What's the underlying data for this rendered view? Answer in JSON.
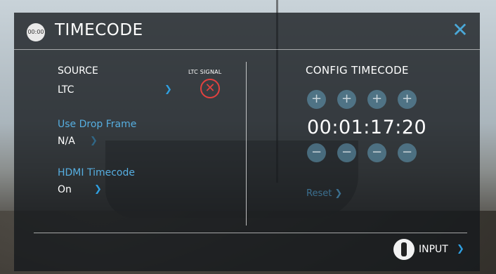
{
  "header": {
    "icon_text": "00:00",
    "title": "TIMECODE",
    "close_glyph": "✕"
  },
  "source": {
    "label": "SOURCE",
    "value": "LTC",
    "ltc_signal_label": "LTC SIGNAL",
    "ltc_status_glyph": "✕"
  },
  "drop_frame": {
    "label": "Use Drop Frame",
    "value": "N/A"
  },
  "hdmi_timecode": {
    "label": "HDMI Timecode",
    "value": "On"
  },
  "config": {
    "title": "CONFIG TIMECODE",
    "timecode": "00:01:17:20",
    "plus_glyph": "+",
    "minus_glyph": "−",
    "reset_label": "Reset"
  },
  "footer": {
    "input_label": "INPUT"
  },
  "chevron_glyph": "❯",
  "colors": {
    "accent": "#2f9fe0",
    "label_blue": "#56aee0",
    "error_red": "#e3413f"
  },
  "icons": [
    "timecode-icon",
    "close-icon",
    "chevron-right-icon",
    "ltc-signal-error-icon",
    "plus-icon",
    "minus-icon",
    "bnc-connector-icon"
  ]
}
